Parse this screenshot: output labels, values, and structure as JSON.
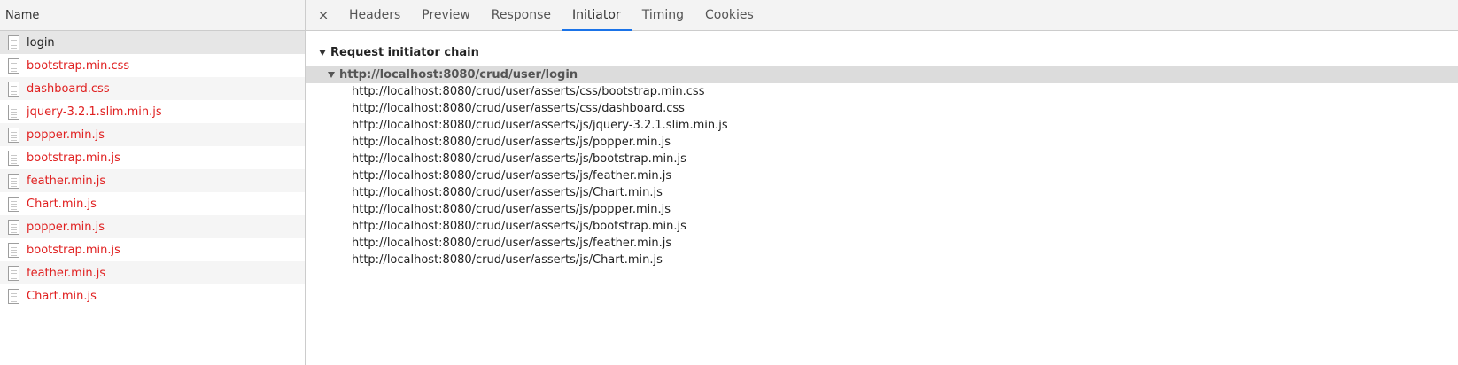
{
  "left_panel": {
    "header": "Name",
    "requests": [
      {
        "name": "login",
        "status": "ok"
      },
      {
        "name": "bootstrap.min.css",
        "status": "error"
      },
      {
        "name": "dashboard.css",
        "status": "error"
      },
      {
        "name": "jquery-3.2.1.slim.min.js",
        "status": "error"
      },
      {
        "name": "popper.min.js",
        "status": "error"
      },
      {
        "name": "bootstrap.min.js",
        "status": "error"
      },
      {
        "name": "feather.min.js",
        "status": "error"
      },
      {
        "name": "Chart.min.js",
        "status": "error"
      },
      {
        "name": "popper.min.js",
        "status": "error"
      },
      {
        "name": "bootstrap.min.js",
        "status": "error"
      },
      {
        "name": "feather.min.js",
        "status": "error"
      },
      {
        "name": "Chart.min.js",
        "status": "error"
      }
    ]
  },
  "tabs": {
    "close_symbol": "×",
    "items": [
      "Headers",
      "Preview",
      "Response",
      "Initiator",
      "Timing",
      "Cookies"
    ],
    "active": "Initiator"
  },
  "initiator": {
    "section_title": "Request initiator chain",
    "root": "http://localhost:8080/crud/user/login",
    "children": [
      "http://localhost:8080/crud/user/asserts/css/bootstrap.min.css",
      "http://localhost:8080/crud/user/asserts/css/dashboard.css",
      "http://localhost:8080/crud/user/asserts/js/jquery-3.2.1.slim.min.js",
      "http://localhost:8080/crud/user/asserts/js/popper.min.js",
      "http://localhost:8080/crud/user/asserts/js/bootstrap.min.js",
      "http://localhost:8080/crud/user/asserts/js/feather.min.js",
      "http://localhost:8080/crud/user/asserts/js/Chart.min.js",
      "http://localhost:8080/crud/user/asserts/js/popper.min.js",
      "http://localhost:8080/crud/user/asserts/js/bootstrap.min.js",
      "http://localhost:8080/crud/user/asserts/js/feather.min.js",
      "http://localhost:8080/crud/user/asserts/js/Chart.min.js"
    ]
  },
  "colors": {
    "error_text": "#e02020",
    "active_tab_underline": "#1a73e8",
    "root_row_bg": "#dcdcdc"
  },
  "icons": {
    "request_file": "file-icon",
    "close": "close-icon",
    "expand": "triangle-down-icon"
  }
}
